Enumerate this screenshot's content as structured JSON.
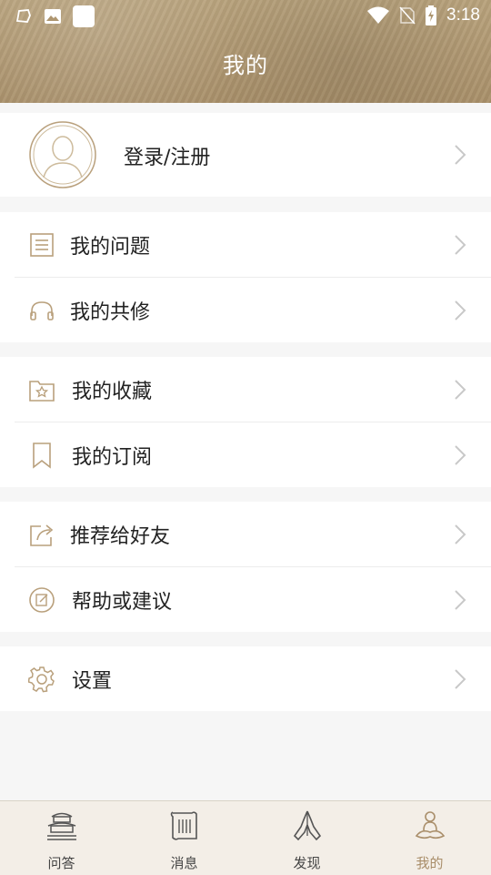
{
  "status_bar": {
    "time": "3:18"
  },
  "header": {
    "title": "我的"
  },
  "profile": {
    "login_label": "登录/注册"
  },
  "menu": {
    "my_questions": "我的问题",
    "my_practice": "我的共修",
    "my_favorites": "我的收藏",
    "my_subscriptions": "我的订阅",
    "recommend": "推荐给好友",
    "help": "帮助或建议",
    "settings": "设置"
  },
  "tabs": [
    {
      "label": "问答",
      "icon": "temple-icon"
    },
    {
      "label": "消息",
      "icon": "scroll-icon"
    },
    {
      "label": "发现",
      "icon": "praying-hands-icon"
    },
    {
      "label": "我的",
      "icon": "meditation-icon",
      "active": true
    }
  ],
  "colors": {
    "accent": "#a98e6a",
    "icon": "#b9a07c",
    "header": "#ae9670"
  }
}
